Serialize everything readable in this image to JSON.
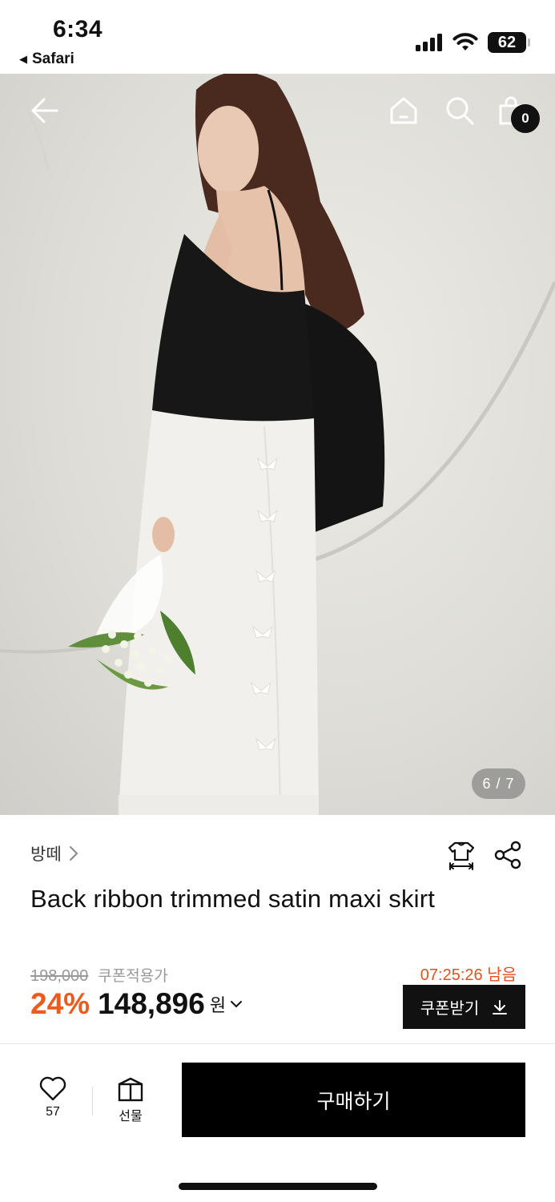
{
  "status_bar": {
    "time": "6:34",
    "back_app": "Safari",
    "battery": "62",
    "icons": [
      "signal-icon",
      "wifi-icon",
      "battery-icon"
    ]
  },
  "hero": {
    "nav_icons": [
      "back-arrow-icon",
      "home-icon",
      "search-icon",
      "shopping-bag-icon"
    ],
    "cart_count": "0",
    "image_counter": "6 / 7"
  },
  "product": {
    "brand": "방떼",
    "title": "Back ribbon trimmed satin maxi skirt",
    "original_price": "198,000",
    "coupon_applied_label": "쿠폰적용가",
    "countdown": "07:25:26 남음",
    "discount": "24%",
    "price": "148,896",
    "currency": "원",
    "coupon_button": "쿠폰받기",
    "icons": [
      "size-guide-icon",
      "share-icon"
    ]
  },
  "bottom_bar": {
    "like_count": "57",
    "gift_label": "선물",
    "buy_label": "구매하기"
  },
  "colors": {
    "accent": "#ef5a1c",
    "countdown": "#e2511f",
    "button_bg": "#000000"
  }
}
